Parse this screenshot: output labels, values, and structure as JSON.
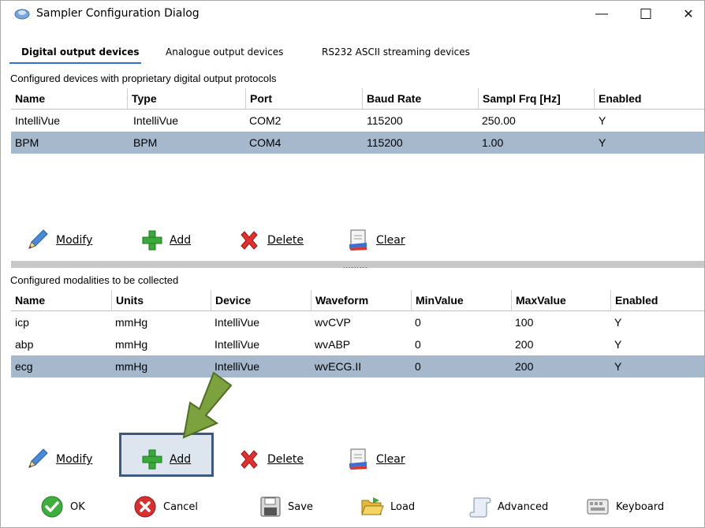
{
  "window": {
    "title": "Sampler Configuration Dialog",
    "minimize": "—",
    "maximize": "☐",
    "close": "✕"
  },
  "tabs": [
    {
      "label": "Digital output devices",
      "active": true
    },
    {
      "label": "Analogue output devices",
      "active": false
    },
    {
      "label": "RS232 ASCII streaming devices",
      "active": false
    }
  ],
  "devices": {
    "section_label": "Configured devices with proprietary digital output protocols",
    "columns": [
      "Name",
      "Type",
      "Port",
      "Baud Rate",
      "Sampl Frq [Hz]",
      "Enabled"
    ],
    "rows": [
      [
        "IntelliVue",
        "IntelliVue",
        "COM2",
        "115200",
        "250.00",
        "Y"
      ],
      [
        "BPM",
        "BPM",
        "COM4",
        "115200",
        "1.00",
        "Y"
      ]
    ],
    "selected_row": 1,
    "toolbar": {
      "modify": "Modify",
      "add": "Add",
      "delete": "Delete",
      "clear": "Clear"
    }
  },
  "splitter": {
    "grip": "........."
  },
  "modalities": {
    "section_label": "Configured modalities to be collected",
    "columns": [
      "Name",
      "Units",
      "Device",
      "Waveform",
      "MinValue",
      "MaxValue",
      "Enabled"
    ],
    "rows": [
      [
        "icp",
        "mmHg",
        "IntelliVue",
        "wvCVP",
        "0",
        "100",
        "Y"
      ],
      [
        "abp",
        "mmHg",
        "IntelliVue",
        "wvABP",
        "0",
        "200",
        "Y"
      ],
      [
        "ecg",
        "mmHg",
        "IntelliVue",
        "wvECG.II",
        "0",
        "200",
        "Y"
      ]
    ],
    "selected_row": 2,
    "toolbar": {
      "modify": "Modify",
      "add": "Add",
      "delete": "Delete",
      "clear": "Clear"
    }
  },
  "bottom_bar": {
    "ok": "OK",
    "cancel": "Cancel",
    "save": "Save",
    "load": "Load",
    "advanced": "Advanced",
    "keyboard": "Keyboard"
  },
  "colors": {
    "selection": "#a6b8cc",
    "tab_underline": "#2c6fd6",
    "highlight_border": "#3d5a7e",
    "arrow": "#7ba23f"
  }
}
